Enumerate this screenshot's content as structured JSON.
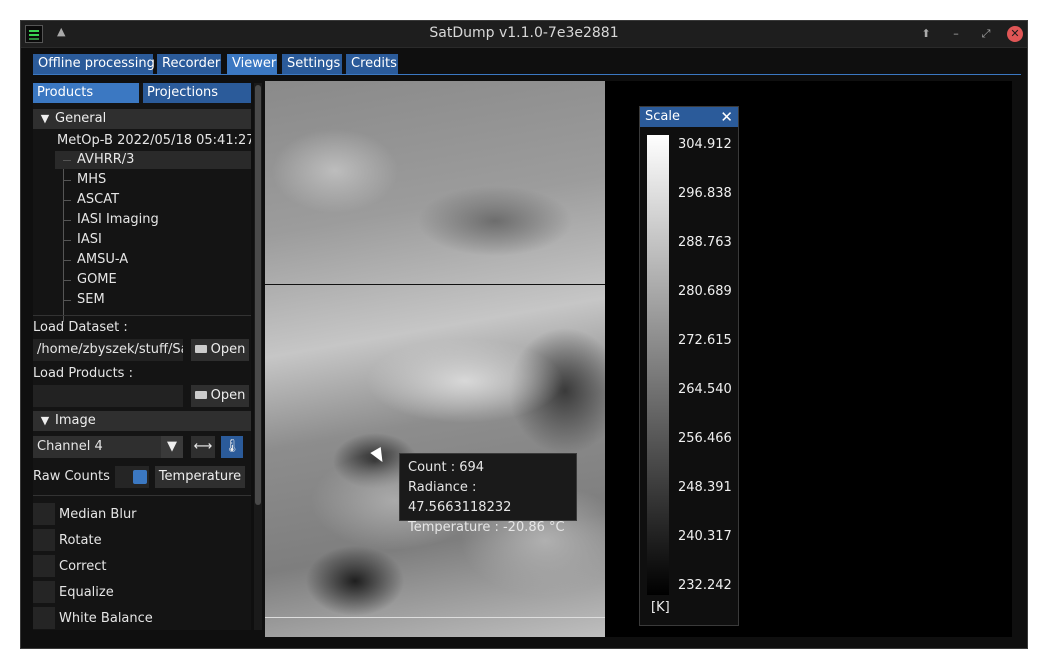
{
  "window": {
    "title": "SatDump v1.1.0-7e3e2881",
    "keep_above_glyph": "▲",
    "pin_glyph": "⬆",
    "minimize_glyph": "–",
    "restore_glyph": "⤢",
    "close_glyph": "✕"
  },
  "tabs": [
    {
      "label": "Offline processing"
    },
    {
      "label": "Recorder"
    },
    {
      "label": "Viewer"
    },
    {
      "label": "Settings"
    },
    {
      "label": "Credits"
    }
  ],
  "left": {
    "subtabs": [
      {
        "label": "Products"
      },
      {
        "label": "Projections"
      }
    ],
    "general": {
      "header": "General",
      "dataset": "MetOp-B 2022/05/18 05:41:27",
      "instruments": [
        "AVHRR/3",
        "MHS",
        "ASCAT",
        "IASI Imaging",
        "IASI",
        "AMSU-A",
        "GOME",
        "SEM"
      ],
      "selected": 0
    },
    "load_dataset": {
      "label": "Load Dataset :",
      "path": "/home/zbyszek/stuff/Sa",
      "open_label": "Open"
    },
    "load_products": {
      "label": "Load Products :",
      "path": "",
      "open_label": "Open"
    },
    "image": {
      "header": "Image",
      "channel": "Channel 4",
      "raw_counts_label": "Raw Counts",
      "temperature_label": "Temperature",
      "options": [
        "Median Blur",
        "Rotate",
        "Correct",
        "Equalize",
        "White Balance"
      ]
    }
  },
  "tooltip": {
    "count": "Count : 694",
    "radiance": "Radiance : 47.5663118232",
    "temperature": "Temperature : -20.86 °C"
  },
  "scale": {
    "title": "Scale",
    "labels": [
      "304.912",
      "296.838",
      "288.763",
      "280.689",
      "272.615",
      "264.540",
      "256.466",
      "248.391",
      "240.317",
      "232.242"
    ],
    "unit": "[K]"
  }
}
